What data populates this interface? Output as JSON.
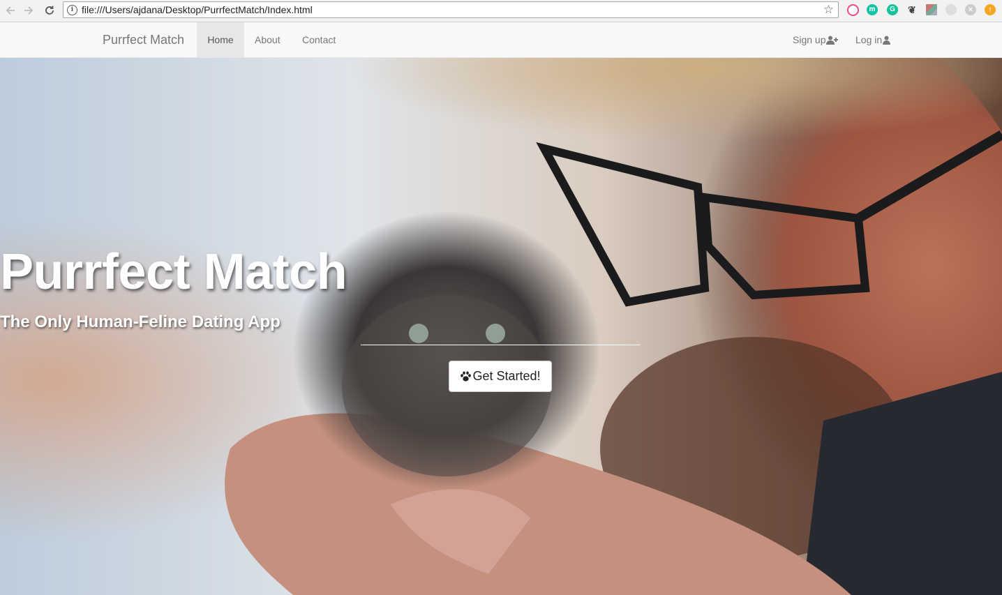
{
  "browser": {
    "url": "file:///Users/ajdana/Desktop/PurrfectMatch/Index.html",
    "back_icon": "arrow-left-icon",
    "forward_icon": "arrow-right-icon",
    "reload_icon": "reload-icon",
    "info_glyph": "i",
    "extensions": [
      "dribbble-icon",
      "m-icon",
      "grammarly-icon",
      "evernote-icon",
      "image-icon",
      "link-icon",
      "close-icon",
      "upload-icon"
    ]
  },
  "navbar": {
    "brand": "Purrfect Match",
    "items": [
      {
        "label": "Home",
        "active": true
      },
      {
        "label": "About",
        "active": false
      },
      {
        "label": "Contact",
        "active": false
      }
    ],
    "signup": "Sign up",
    "login": "Log in"
  },
  "hero": {
    "title": "Purrfect Match",
    "subtitle": "The Only Human-Feline Dating App",
    "cta": "Get Started!"
  },
  "colors": {
    "navbar_bg": "#f8f8f8",
    "nav_active_bg": "#e7e7e7",
    "nav_text": "#777777"
  }
}
